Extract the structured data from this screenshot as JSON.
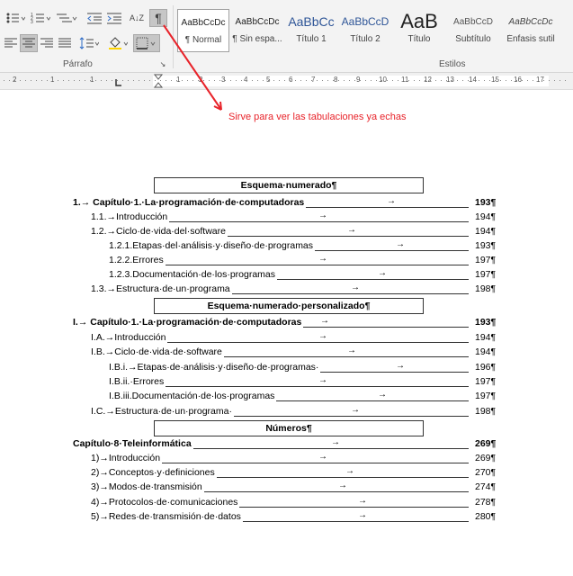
{
  "ribbon": {
    "paragraph_group_label": "Párrafo",
    "styles_group_label": "Estilos",
    "pilcrow_label": "¶",
    "sort_label": "A↓Z",
    "styles": [
      {
        "sample": "AaBbCcDc",
        "name": "¶ Normal",
        "selected": true
      },
      {
        "sample": "AaBbCcDc",
        "name": "¶ Sin espa...",
        "selected": false
      },
      {
        "sample": "AaBbCc",
        "name": "Título 1",
        "selected": false
      },
      {
        "sample": "AaBbCcD",
        "name": "Título 2",
        "selected": false
      },
      {
        "sample": "AaB",
        "name": "Título",
        "selected": false
      },
      {
        "sample": "AaBbCcD",
        "name": "Subtítulo",
        "selected": false
      },
      {
        "sample": "AaBbCcDc",
        "name": "Énfasis sutil",
        "selected": false
      }
    ]
  },
  "ruler": {
    "left_numbers": [
      "2",
      "1",
      "1"
    ],
    "right_numbers": [
      "1",
      "2",
      "3",
      "4",
      "5",
      "6",
      "7",
      "8",
      "9",
      "10",
      "11",
      "12",
      "13",
      "14",
      "15",
      "16",
      "17"
    ]
  },
  "annotation": {
    "text": "Sirve para ver las tabulaciones ya echas",
    "color": "#e8232a"
  },
  "document": {
    "headings": [
      "Esquema·numerado¶",
      "Esquema·numerado·personalizado¶",
      "Números¶"
    ],
    "section1": [
      {
        "text": "1.→ Capítulo·1.·La·programación·de·computadoras",
        "page": "193¶",
        "bold": true
      },
      {
        "text": "1.1.→Introducción",
        "page": "194¶",
        "bold": false
      },
      {
        "text": "1.2.→Ciclo·de·vida·del·software",
        "page": "194¶",
        "bold": false
      },
      {
        "text": "1.2.1.Etapas·del·análisis·y·diseño·de·programas",
        "page": "193¶",
        "bold": false
      },
      {
        "text": "1.2.2.Errores",
        "page": "197¶",
        "bold": false
      },
      {
        "text": "1.2.3.Documentación·de·los·programas",
        "page": "197¶",
        "bold": false
      },
      {
        "text": "1.3.→Estructura·de·un·programa",
        "page": "198¶",
        "bold": false
      }
    ],
    "section2": [
      {
        "text": "I.→ Capítulo·1.·La·programación·de·computadoras",
        "page": "193¶",
        "bold": true
      },
      {
        "text": "I.A.→Introducción",
        "page": "194¶",
        "bold": false
      },
      {
        "text": "I.B.→Ciclo·de·vida·de·software",
        "page": "194¶",
        "bold": false
      },
      {
        "text": "I.B.i.→Etapas·de·análisis·y·diseño·de·programas·",
        "page": "196¶",
        "bold": false
      },
      {
        "text": "I.B.ii.·Errores",
        "page": "197¶",
        "bold": false
      },
      {
        "text": "I.B.iii.Documentación·de·los·programas",
        "page": "197¶",
        "bold": false
      },
      {
        "text": "I.C.→Estructura·de·un·programa·",
        "page": "198¶",
        "bold": false
      }
    ],
    "section3": [
      {
        "text": "Capítulo·8·Teleinformática",
        "page": "269¶",
        "bold": true
      },
      {
        "text": "1)→Introducción",
        "page": "269¶",
        "bold": false
      },
      {
        "text": "2)→Conceptos·y·definiciones",
        "page": "270¶",
        "bold": false
      },
      {
        "text": "3)→Modos·de·transmisión",
        "page": "274¶",
        "bold": false
      },
      {
        "text": "4)→Protocolos·de·comunicaciones",
        "page": "278¶",
        "bold": false
      },
      {
        "text": "5)→Redes·de·transmisión·de·datos",
        "page": "280¶",
        "bold": false
      }
    ]
  }
}
